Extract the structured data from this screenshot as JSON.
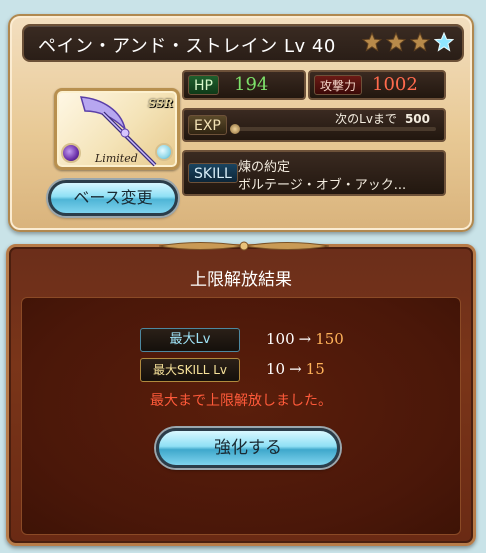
{
  "character": {
    "name_title": "ペイン・アンド・ストレイン Lv 40",
    "rarity": "SSR",
    "limited_label": "Limited",
    "stars": [
      {
        "icon": "star-bronze-icon"
      },
      {
        "icon": "star-bronze-icon"
      },
      {
        "icon": "star-bronze-icon"
      },
      {
        "icon": "star-blue-icon"
      }
    ]
  },
  "stats": {
    "hp_label": "HP",
    "hp_value": "194",
    "atk_label": "攻撃力",
    "atk_value": "1002",
    "exp_label": "EXP",
    "exp_next_label": "次のLvまで",
    "exp_next_value": "500",
    "exp_progress": 0
  },
  "skill": {
    "label": "SKILL",
    "line1": "煉の約定",
    "line2": "ボルテージ・オブ・アック..."
  },
  "buttons": {
    "base_change": "ベース変更",
    "enhance": "強化する"
  },
  "result": {
    "title": "上限解放結果",
    "max_lv_label": "最大Lv",
    "max_lv_old": "100",
    "max_lv_new": "150",
    "max_skill_label": "最大SKILL Lv",
    "max_skill_old": "10",
    "max_skill_new": "15",
    "arrow": "→",
    "message": "最大まで上限解放しました。"
  },
  "colors": {
    "hp_value": "#7de06a",
    "atk_value": "#ff6a4d",
    "new_value": "#ffb35a",
    "message": "#ff5a3a"
  }
}
